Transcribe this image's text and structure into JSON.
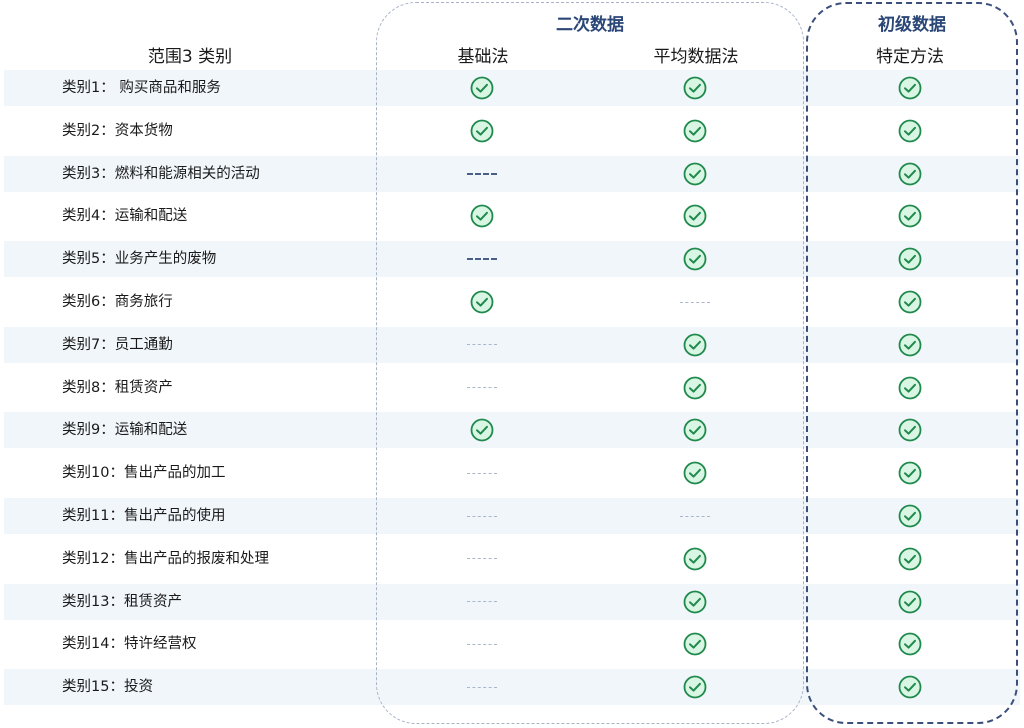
{
  "header": {
    "category_header": "范围3 类别",
    "secondary_group": "二次数据",
    "primary_group": "初级数据",
    "columns": [
      "基础法",
      "平均数据法",
      "特定方法"
    ]
  },
  "chart_data": {
    "type": "table",
    "columns": [
      "基础法",
      "平均数据法",
      "特定方法"
    ],
    "column_groups": [
      {
        "name": "二次数据",
        "columns": [
          "基础法",
          "平均数据法"
        ]
      },
      {
        "name": "初级数据",
        "columns": [
          "特定方法"
        ]
      }
    ],
    "rows": [
      {
        "label": "类别1： 购买商品和服务",
        "values": [
          "check",
          "check",
          "check"
        ]
      },
      {
        "label": "类别2：资本货物",
        "values": [
          "check",
          "check",
          "check"
        ]
      },
      {
        "label": "类别3：燃料和能源相关的活动",
        "values": [
          "dash",
          "check",
          "check"
        ]
      },
      {
        "label": "类别4：运输和配送",
        "values": [
          "check",
          "check",
          "check"
        ]
      },
      {
        "label": "类别5：业务产生的废物",
        "values": [
          "dash",
          "check",
          "check"
        ]
      },
      {
        "label": "类别6：商务旅行",
        "values": [
          "check",
          "dash-light",
          "check"
        ]
      },
      {
        "label": "类别7：员工通勤",
        "values": [
          "dash-light",
          "check",
          "check"
        ]
      },
      {
        "label": "类别8：租赁资产",
        "values": [
          "dash-light",
          "check",
          "check"
        ]
      },
      {
        "label": "类别9：运输和配送",
        "values": [
          "check",
          "check",
          "check"
        ]
      },
      {
        "label": "类别10：售出产品的加工",
        "values": [
          "dash-light",
          "check",
          "check"
        ]
      },
      {
        "label": "类别11：售出产品的使用",
        "values": [
          "dash-light",
          "dash-light",
          "check"
        ]
      },
      {
        "label": "类别12：售出产品的报废和处理",
        "values": [
          "dash-light",
          "check",
          "check"
        ]
      },
      {
        "label": "类别13：租赁资产",
        "values": [
          "dash-light",
          "check",
          "check"
        ]
      },
      {
        "label": "类别14：特许经营权",
        "values": [
          "dash-light",
          "check",
          "check"
        ]
      },
      {
        "label": "类别15：投资",
        "values": [
          "dash-light",
          "check",
          "check"
        ]
      }
    ]
  },
  "colors": {
    "check_fill": "#d9f5e3",
    "check_stroke": "#1f8a4c",
    "stripe": "#f1f6fb",
    "group_title": "#2b4777"
  }
}
